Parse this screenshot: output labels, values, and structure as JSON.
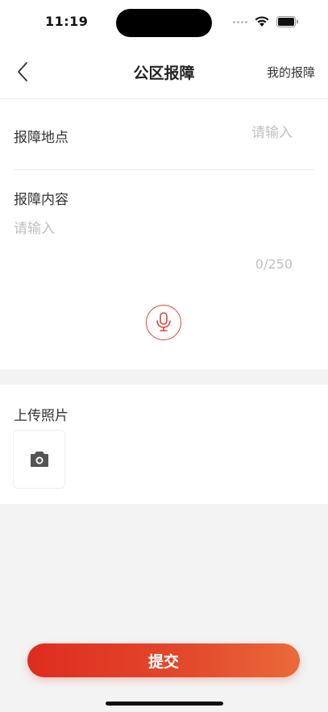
{
  "status_bar": {
    "time": "11:19"
  },
  "nav": {
    "title": "公区报障",
    "right_link": "我的报障"
  },
  "form": {
    "location_label": "报障地点",
    "location_placeholder": "请输入",
    "content_label": "报障内容",
    "content_placeholder": "请输入",
    "char_count": "0/250"
  },
  "photos": {
    "label": "上传照片"
  },
  "submit_label": "提交",
  "colors": {
    "accent": "#e0463a",
    "placeholder": "#c0c0c0",
    "background": "#f3f3f3"
  },
  "icons": {
    "back": "chevron-left-icon",
    "mic": "microphone-icon",
    "camera": "camera-icon",
    "wifi": "wifi-icon",
    "battery": "battery-icon"
  }
}
